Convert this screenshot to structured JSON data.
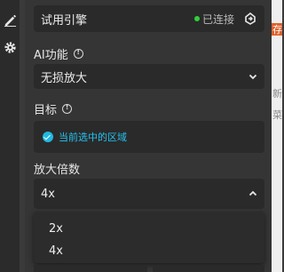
{
  "left_rail": {
    "icons": [
      "edit-icon",
      "gear-icon"
    ]
  },
  "engine": {
    "name": "试用引擎",
    "status": "已连接",
    "status_color": "#2fd13a"
  },
  "ai_function": {
    "label": "AI功能",
    "value": "无损放大"
  },
  "target": {
    "label": "目标",
    "value": "当前选中的区域",
    "accent": "#22c3f0"
  },
  "scale": {
    "label": "放大倍数",
    "value": "4x",
    "options": [
      "2x",
      "4x"
    ]
  },
  "right_strip": {
    "chars": [
      "存",
      "新",
      "菜"
    ]
  }
}
